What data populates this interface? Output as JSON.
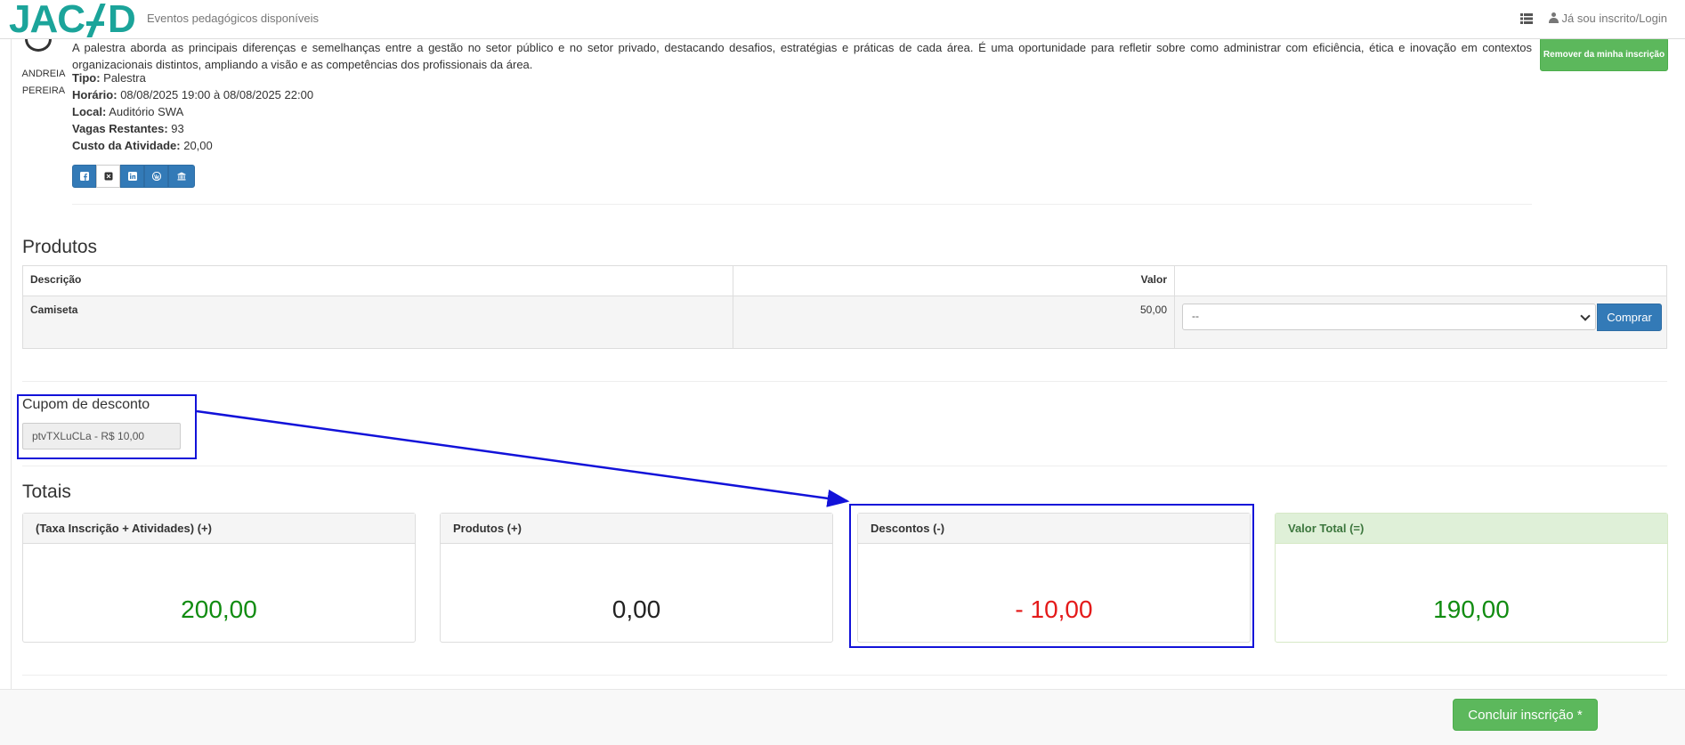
{
  "navbar": {
    "logo_text": "JACAD",
    "events_link": "Eventos pedagógicos disponíveis",
    "login_link": "Já sou inscrito/Login"
  },
  "activity": {
    "speaker_first": "ANDREIA",
    "speaker_last": "PEREIRA",
    "description": "A palestra aborda as principais diferenças e semelhanças entre a gestão no setor público e no setor privado, destacando desafios, estratégias e práticas de cada área. É uma oportunidade para refletir sobre como administrar com eficiência, ética e inovação em contextos organizacionais distintos, ampliando a visão e as competências dos profissionais da área.",
    "tipo_label": "Tipo:",
    "tipo_value": "Palestra",
    "horario_label": "Horário:",
    "horario_value": "08/08/2025 19:00 à 08/08/2025 22:00",
    "local_label": "Local:",
    "local_value": "Auditório SWA",
    "vagas_label": "Vagas Restantes:",
    "vagas_value": "93",
    "custo_label": "Custo da Atividade:",
    "custo_value": "20,00",
    "remove_button": "Remover da minha inscrição",
    "share_icons": [
      "facebook-icon",
      "x-icon",
      "linkedin-icon",
      "wordpress-icon",
      "institution-icon"
    ]
  },
  "products": {
    "title": "Produtos",
    "headers": [
      "Descrição",
      "Valor",
      ""
    ],
    "rows": [
      {
        "description": "Camiseta",
        "value": "50,00",
        "select_value": "--"
      }
    ],
    "buy_button": "Comprar"
  },
  "coupon": {
    "title": "Cupom de desconto",
    "value": "ptvTXLuCLa - R$  10,00"
  },
  "totals": {
    "title": "Totais",
    "panels": [
      {
        "label": "(Taxa Inscrição + Atividades) (+)",
        "value": "200,00",
        "color": "#118c11"
      },
      {
        "label": "Produtos (+)",
        "value": "0,00",
        "color": "#222222"
      },
      {
        "label": "Descontos (-)",
        "value": "- 10,00",
        "color": "#e41a1a"
      },
      {
        "label": "Valor Total (=)",
        "value": "190,00",
        "color": "#118c11"
      }
    ]
  },
  "footer": {
    "finish_button": "Concluir inscrição *"
  },
  "colors": {
    "brand": "#1ba49a",
    "primary": "#337ab7",
    "success": "#5cb85c",
    "highlight": "#1212d9"
  }
}
